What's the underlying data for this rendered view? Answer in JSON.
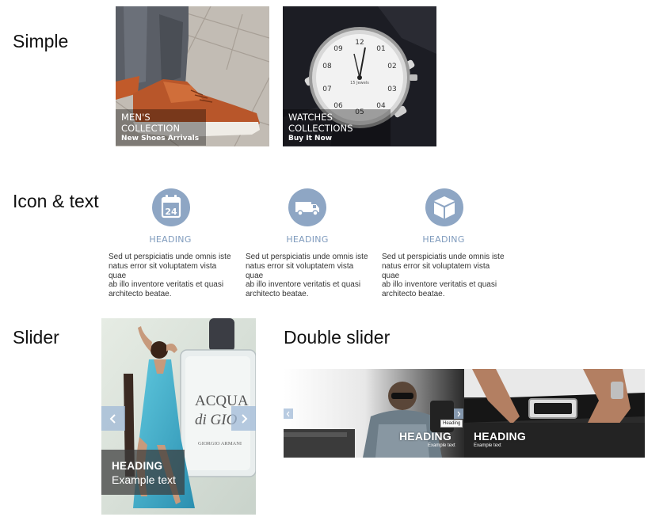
{
  "sections": {
    "simple": "Simple",
    "icon_text": "Icon & text",
    "slider": "Slider",
    "double_slider": "Double slider"
  },
  "simple_banners": [
    {
      "title": "MEN'S COLLECTION",
      "subtitle": "New Shoes Arrivals",
      "image": "shoes-photo"
    },
    {
      "title": "WATCHES COLLECTIONS",
      "subtitle": "Buy It Now",
      "image": "watch-photo"
    }
  ],
  "features": [
    {
      "icon": "calendar-icon",
      "icon_text": "24",
      "heading": "HEADING",
      "lines": [
        "Sed ut perspiciatis unde omnis iste",
        "natus error sit voluptatem vista quae",
        "ab illo inventore veritatis et quasi",
        "architecto beatae."
      ]
    },
    {
      "icon": "truck-icon",
      "heading": "HEADING",
      "lines": [
        "Sed ut perspiciatis unde omnis iste",
        "natus error sit voluptatem vista quae",
        "ab illo inventore veritatis et quasi",
        "architecto beatae."
      ]
    },
    {
      "icon": "box-icon",
      "heading": "HEADING",
      "lines": [
        "Sed ut perspiciatis unde omnis iste",
        "natus error sit voluptatem vista quae",
        "ab illo inventore veritatis et quasi",
        "architecto beatae."
      ]
    }
  ],
  "slider": {
    "heading": "HEADING",
    "text": "Example text",
    "bottle_brand": "ACQUA",
    "bottle_brand2": "di GIO",
    "bottle_maker": "GIORGIO ARMANI",
    "prev_icon": "chevron-left-icon",
    "next_icon": "chevron-right-icon"
  },
  "double_slider": {
    "slides": [
      {
        "heading": "HEADING",
        "text": "Example text",
        "tag": "Heading"
      },
      {
        "heading": "HEADING",
        "text": "Example text"
      }
    ],
    "prev_icon": "chevron-left-icon",
    "next_icon": "chevron-right-icon"
  },
  "colors": {
    "accent": "#8ea6c4",
    "heading_blue": "#7f9bbd",
    "caption_bg": "#3c3c3c"
  }
}
